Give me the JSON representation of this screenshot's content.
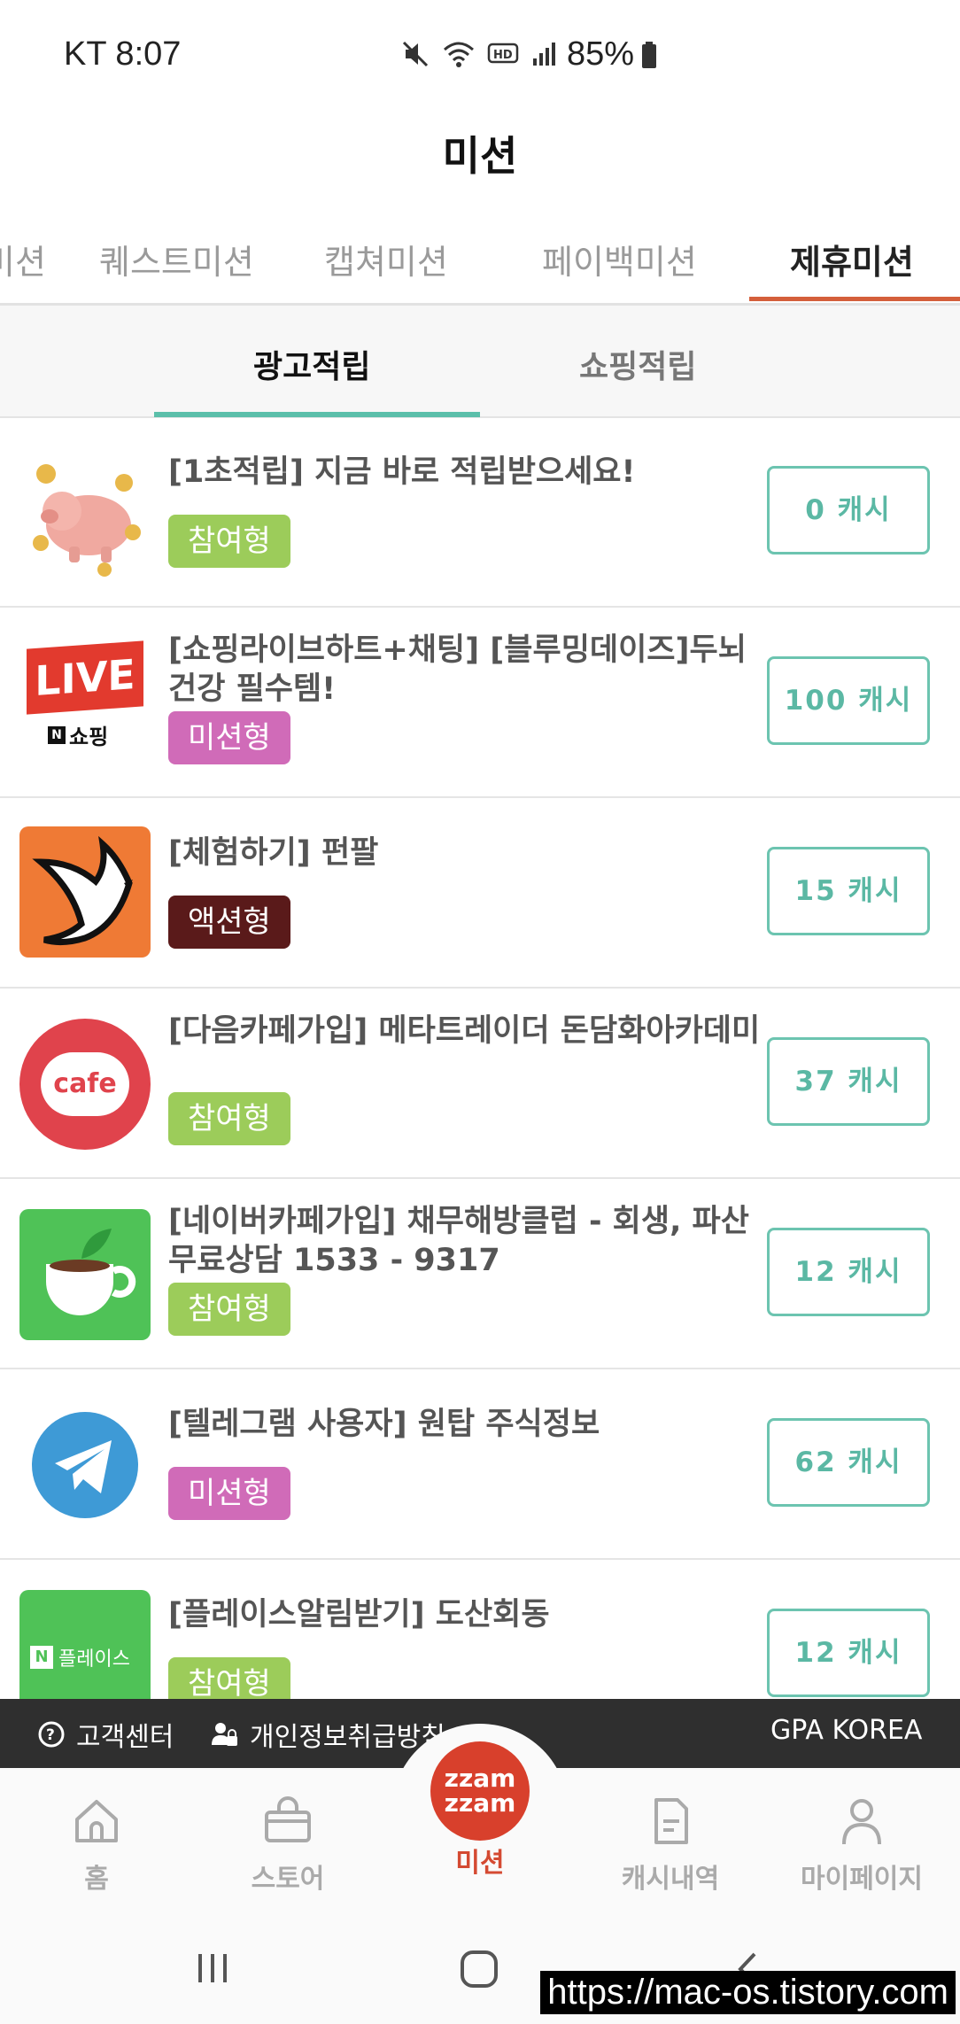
{
  "status": {
    "carrier_time": "KT 8:07",
    "battery": "85%"
  },
  "header": {
    "title": "미션"
  },
  "top_tabs": [
    "미션",
    "퀘스트미션",
    "캡쳐미션",
    "페이백미션",
    "제휴미션"
  ],
  "sub_tabs": [
    "광고적립",
    "쇼핑적립"
  ],
  "missions": [
    {
      "title": "[1초적립] 지금 바로 적립받으세요!",
      "badge": "참여형",
      "badge_color": "#9ccc5a",
      "cash": "0 캐시",
      "icon": "piggy-bank-icon"
    },
    {
      "title": "[쇼핑라이브하트+채팅] [블루밍데이즈]두뇌건강 필수템!",
      "badge": "미션형",
      "badge_color": "#d06bb8",
      "cash": "100 캐시",
      "icon": "live-shopping-icon"
    },
    {
      "title": "[체험하기] 펀팔",
      "badge": "액션형",
      "badge_color": "#5a1a1a",
      "cash": "15 캐시",
      "icon": "dove-icon"
    },
    {
      "title": "[다음카페가입] 메타트레이더 돈담화아카데미",
      "badge": "참여형",
      "badge_color": "#9ccc5a",
      "cash": "37 캐시",
      "icon": "daum-cafe-icon"
    },
    {
      "title": "[네이버카페가입] 채무해방클럽 - 회생, 파산 무료상담 1533 - 9317",
      "badge": "참여형",
      "badge_color": "#9ccc5a",
      "cash": "12 캐시",
      "icon": "naver-cafe-icon"
    },
    {
      "title": "[텔레그램 사용자] 원탑 주식정보",
      "badge": "미션형",
      "badge_color": "#d06bb8",
      "cash": "62 캐시",
      "icon": "telegram-icon"
    },
    {
      "title": "[플레이스알림받기] 도산회동",
      "badge": "참여형",
      "badge_color": "#9ccc5a",
      "cash": "12 캐시",
      "icon": "naver-place-icon"
    }
  ],
  "icon_texts": {
    "live": "LIVE",
    "shopping": "쇼핑",
    "cafe": "cafe",
    "place": "플레이스",
    "naver_n": "N",
    "zzam1": "zzam",
    "zzam2": "zzam"
  },
  "footer": {
    "support": "고객센터",
    "privacy": "개인정보취급방침",
    "company": "GPA KOREA"
  },
  "bottom_nav": [
    "홈",
    "스토어",
    "미션",
    "캐시내역",
    "마이페이지"
  ],
  "watermark": "https://mac-os.tistory.com"
}
